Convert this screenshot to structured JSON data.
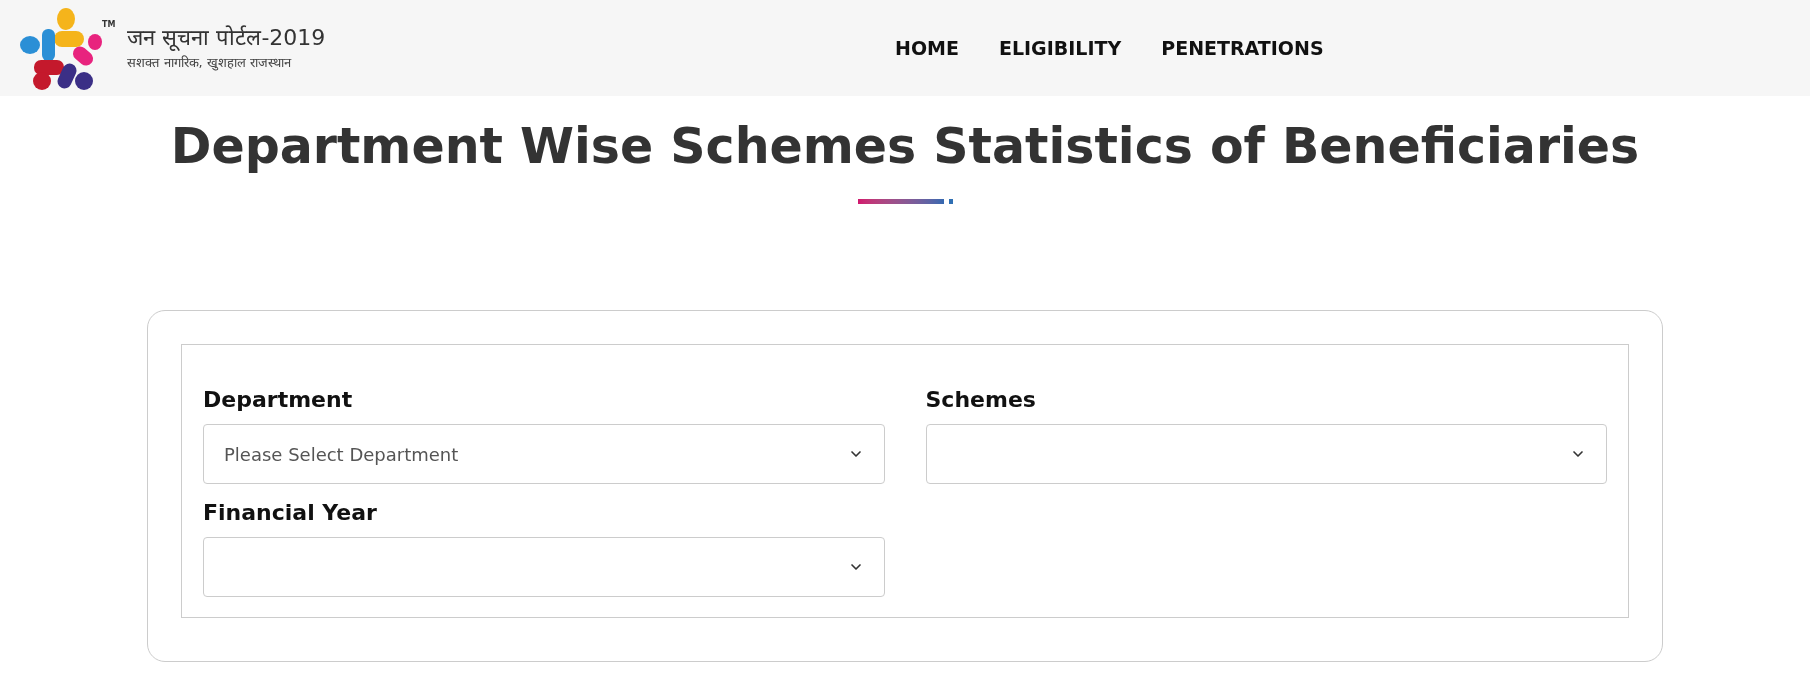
{
  "header": {
    "logo": {
      "mark": "TM",
      "title": "जन सूचना पोर्टल-2019",
      "tagline": "सशक्त नागरिक, खुशहाल राजस्थान"
    },
    "nav": [
      {
        "label": "HOME"
      },
      {
        "label": "ELIGIBILITY"
      },
      {
        "label": "PENETRATIONS"
      }
    ]
  },
  "page_title": "Department Wise Schemes Statistics of Beneficiaries",
  "form": {
    "fields": [
      {
        "label": "Department",
        "value": "Please Select Department"
      },
      {
        "label": "Schemes"
      },
      {
        "label": "Financial Year"
      }
    ]
  }
}
